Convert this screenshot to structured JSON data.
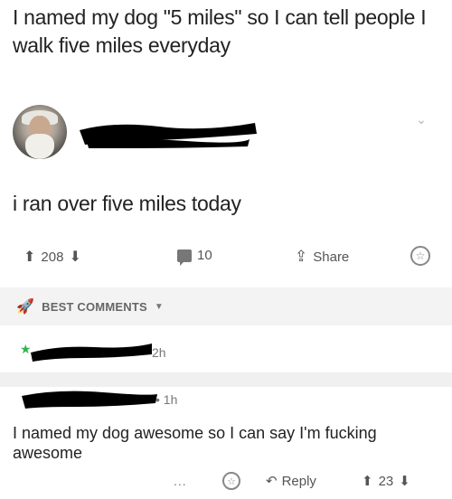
{
  "meme_caption": "I named my dog \"5 miles\" so I can tell people I walk five miles everyday",
  "post": {
    "avatar_icon": "user-avatar",
    "chevron_icon": "chevron-down-icon",
    "body": "i ran over five miles today"
  },
  "actions": {
    "upvotes": "208",
    "comments": "10",
    "share_label": "Share"
  },
  "sort": {
    "label": "BEST COMMENTS"
  },
  "comments": [
    {
      "time": "2h"
    },
    {
      "meta": "• 1h",
      "body": "I named my dog awesome so I can say I'm fucking awesome",
      "more": "...",
      "reply_label": "Reply",
      "score": "23"
    }
  ],
  "colors": {
    "redaction": "#000000",
    "award_green": "#2fb34a",
    "sort_bar_bg": "#f3f3f3"
  }
}
